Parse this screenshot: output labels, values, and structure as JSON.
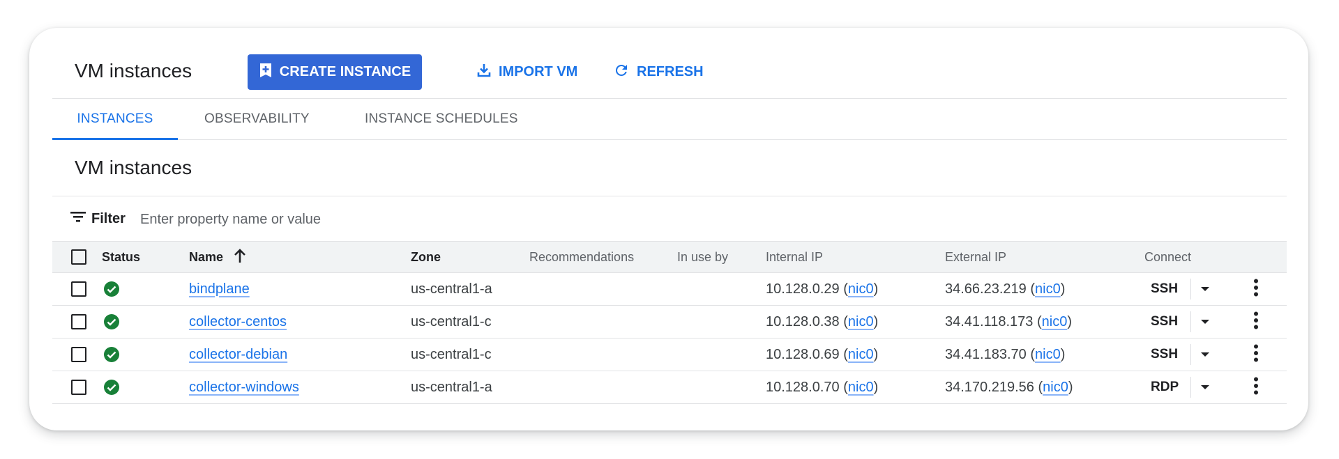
{
  "header": {
    "title": "VM instances",
    "create_label": "CREATE INSTANCE",
    "import_label": "IMPORT VM",
    "refresh_label": "REFRESH"
  },
  "tabs": [
    {
      "label": "INSTANCES",
      "active": true
    },
    {
      "label": "OBSERVABILITY",
      "active": false
    },
    {
      "label": "INSTANCE SCHEDULES",
      "active": false
    }
  ],
  "section_title": "VM instances",
  "filter": {
    "label": "Filter",
    "placeholder": "Enter property name or value"
  },
  "table": {
    "columns": {
      "status": "Status",
      "name": "Name",
      "zone": "Zone",
      "recommendations": "Recommendations",
      "in_use_by": "In use by",
      "internal_ip": "Internal IP",
      "external_ip": "External IP",
      "connect": "Connect"
    },
    "sort": {
      "column": "Name",
      "direction": "ascending"
    },
    "rows": [
      {
        "name": "bindplane",
        "zone": "us-central1-a",
        "internal_ip": "10.128.0.29",
        "internal_nic": "nic0",
        "external_ip": "34.66.23.219",
        "external_nic": "nic0",
        "connect": "SSH",
        "status": "running"
      },
      {
        "name": "collector-centos",
        "zone": "us-central1-c",
        "internal_ip": "10.128.0.38",
        "internal_nic": "nic0",
        "external_ip": "34.41.118.173",
        "external_nic": "nic0",
        "connect": "SSH",
        "status": "running"
      },
      {
        "name": "collector-debian",
        "zone": "us-central1-c",
        "internal_ip": "10.128.0.69",
        "internal_nic": "nic0",
        "external_ip": "34.41.183.70",
        "external_nic": "nic0",
        "connect": "SSH",
        "status": "running"
      },
      {
        "name": "collector-windows",
        "zone": "us-central1-a",
        "internal_ip": "10.128.0.70",
        "internal_nic": "nic0",
        "external_ip": "34.170.219.56",
        "external_nic": "nic0",
        "connect": "RDP",
        "status": "running"
      }
    ]
  },
  "colors": {
    "accent": "#1a73e8",
    "primary_button": "#3367d6",
    "status_ok": "#188038"
  }
}
